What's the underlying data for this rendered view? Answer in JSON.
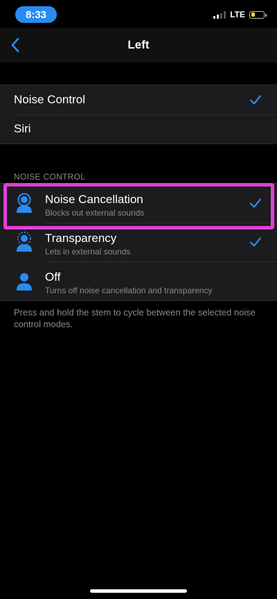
{
  "status_bar": {
    "time": "8:33",
    "network": "LTE"
  },
  "nav": {
    "title": "Left"
  },
  "press_group": {
    "items": [
      {
        "label": "Noise Control",
        "selected": true
      },
      {
        "label": "Siri",
        "selected": false
      }
    ]
  },
  "noise_control": {
    "header": "NOISE CONTROL",
    "items": [
      {
        "title": "Noise Cancellation",
        "subtitle": "Blocks out external sounds",
        "selected": true,
        "icon": "noise-cancellation-icon"
      },
      {
        "title": "Transparency",
        "subtitle": "Lets in external sounds",
        "selected": true,
        "icon": "transparency-icon"
      },
      {
        "title": "Off",
        "subtitle": "Turns off noise cancellation and transparency",
        "selected": false,
        "icon": "noise-off-icon"
      }
    ],
    "footer": "Press and hold the stem to cycle between the selected noise control modes."
  },
  "colors": {
    "accent": "#2a8cf2",
    "highlight": "#e43fd9",
    "battery": "#f4d53a"
  }
}
